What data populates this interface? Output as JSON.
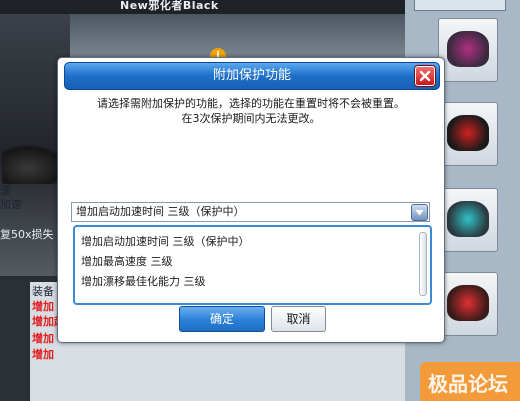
{
  "background": {
    "car_name": "New邪化者Black",
    "left_labels": [
      "速",
      "加速",
      "复50x损失"
    ],
    "equip_label": "装备",
    "red_labels": [
      "增加",
      "增加起动加速时间 三级",
      "增加",
      "增加"
    ],
    "watermark": "极品论坛"
  },
  "dialog": {
    "title": "附加保护功能",
    "description_line1": "请选择需附加保护的功能，选择的功能在重置时将不会被重置。",
    "description_line2": "在3次保护期间内无法更改。",
    "select_value": "增加启动加速时间 三级（保护中）",
    "options": [
      "增加启动加速时间 三级（保护中）",
      "增加最高速度 三级",
      "增加漂移最佳化能力 三级"
    ],
    "confirm_label": "确定",
    "cancel_label": "取消"
  },
  "colors": {
    "title_bar": "#1f6fc8",
    "confirm_button": "#2b7fd6",
    "close_button": "#c81818"
  },
  "icons": {
    "close": "close-icon",
    "dropdown": "chevron-down-icon",
    "info": "info-icon"
  }
}
